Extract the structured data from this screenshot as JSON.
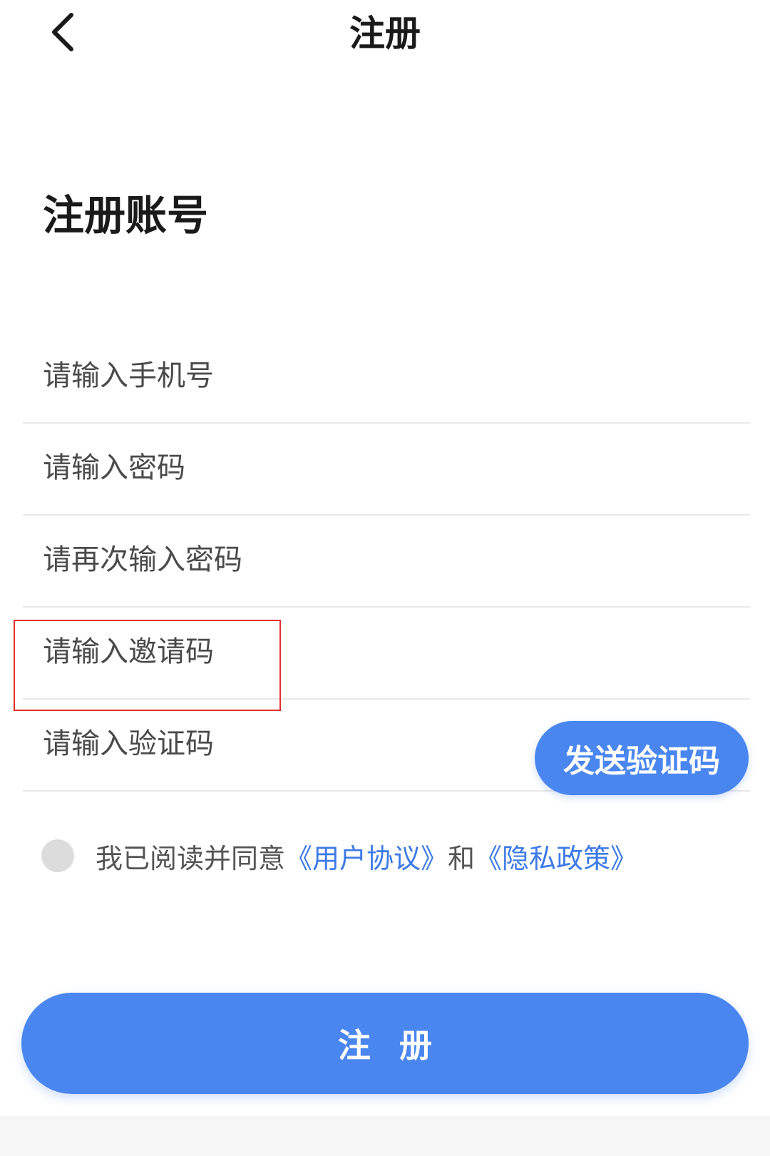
{
  "header": {
    "title": "注册",
    "back_icon": "chevron-left"
  },
  "heading": "注册账号",
  "fields": {
    "phone_placeholder": "请输入手机号",
    "password_placeholder": "请输入密码",
    "password_confirm_placeholder": "请再次输入密码",
    "invite_placeholder": "请输入邀请码",
    "code_placeholder": "请输入验证码"
  },
  "send_code_label": "发送验证码",
  "agreement": {
    "prefix": "我已阅读并同意",
    "user_agreement": "《用户协议》",
    "and": "和",
    "privacy_policy": "《隐私政策》",
    "checked": false
  },
  "register_label": "注册",
  "colors": {
    "accent": "#4a86f0",
    "link": "#3d7ae6",
    "highlight": "#e0322f"
  }
}
